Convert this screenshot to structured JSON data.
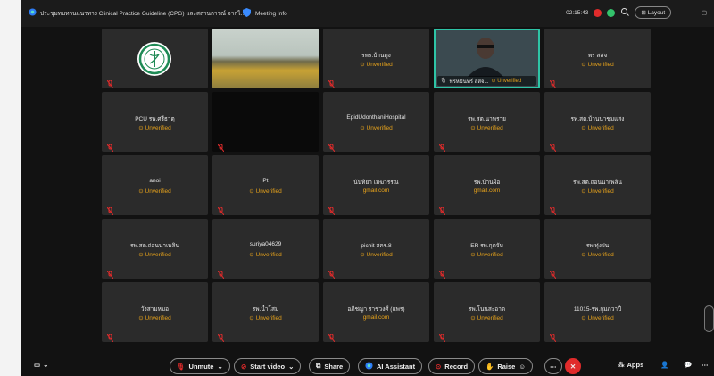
{
  "titlebar": {
    "meeting_title": "ประชุมทบทวนแนวทาง Clinical Practice Guideline (CPG) และสถานการณ์ จากไ...",
    "meeting_info": "Meeting Info",
    "time": "02:15:43",
    "layout_label": "Layout"
  },
  "tiles": [
    {
      "name": "",
      "status": "",
      "kind": "logo"
    },
    {
      "name": "",
      "status": "",
      "kind": "video"
    },
    {
      "name": "รพร.บ้านดุง",
      "status": "Unverified"
    },
    {
      "name": "พรหมินทร์ สสจ...",
      "status": "Unverified",
      "kind": "speaker"
    },
    {
      "name": "พร สสจ",
      "status": "Unverified"
    },
    {
      "name": "PCU รพ.ศรีธาตุ",
      "status": "Unverified"
    },
    {
      "name": "",
      "status": "",
      "kind": "dark"
    },
    {
      "name": "EpidUdonthaniHospital",
      "status": "Unverified"
    },
    {
      "name": "รพ.สต.นาพราย",
      "status": "Unverified"
    },
    {
      "name": "รพ.สต.บ้านนาชุมแสง",
      "status": "Unverified"
    },
    {
      "name": "anoi",
      "status": "Unverified"
    },
    {
      "name": "Pt",
      "status": "Unverified"
    },
    {
      "name": "นันทิยา เมฆวรรณ",
      "status": "gmail.com"
    },
    {
      "name": "รพ.บ้านผือ",
      "status": "gmail.com"
    },
    {
      "name": "รพ.สต.ถ่อนนาเพลิน",
      "status": "Unverified"
    },
    {
      "name": "รพ.สต.ถ่อนนาเพลิน",
      "status": "Unverified"
    },
    {
      "name": "suriya04629",
      "status": "Unverified"
    },
    {
      "name": "pichit สคร.8",
      "status": "Unverified"
    },
    {
      "name": "ER รพ.กุดจับ",
      "status": "Unverified"
    },
    {
      "name": "รพ.ทุ่งฝน",
      "status": "Unverified"
    },
    {
      "name": "วังสามหมอ",
      "status": "Unverified"
    },
    {
      "name": "รพ.น้ำโสม",
      "status": "Unverified"
    },
    {
      "name": "อภิชญา ราชวงศ์ (แพร)",
      "status": "gmail.com"
    },
    {
      "name": "รพ.โนนสะอาด",
      "status": "Unverified"
    },
    {
      "name": "11015-รพ.กุมภวาปี",
      "status": "Unverified"
    }
  ],
  "toolbar": {
    "unmute": "Unmute",
    "start_video": "Start video",
    "share": "Share",
    "ai_assistant": "AI Assistant",
    "record": "Record",
    "raise": "Raise",
    "apps": "Apps"
  },
  "colors": {
    "unverified": "#e6a21b",
    "leave": "#e02b2b",
    "active_border": "#2ec4a6"
  }
}
